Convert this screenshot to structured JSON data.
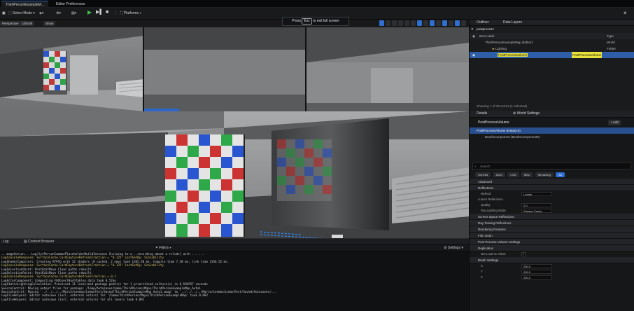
{
  "tabs": [
    {
      "label": "ThirdPersonExampleM..."
    },
    {
      "label": "Editor Preferences"
    }
  ],
  "toolbar": {
    "mode": "Select Mode",
    "platforms": "Platforms"
  },
  "viewport": {
    "buttons": [
      "Perspective",
      "Lit/Unlit",
      "Show"
    ],
    "tooltip_pre": "Press",
    "tooltip_key": "Esc",
    "tooltip_post": "to exit full screen"
  },
  "outliner": {
    "title": "Outliner",
    "tab2": "Data Layers",
    "search": "postprocess",
    "col_label": "Item Label",
    "col_type": "Type",
    "rows": [
      {
        "label": "ThirdPersonExampleMap (Editor)",
        "type": "World"
      },
      {
        "label": "Lighting",
        "type": "Folder"
      },
      {
        "label": "PostProcessVolume",
        "type": "PostProcessVolume"
      }
    ],
    "status": "Showing 1 of 33 actors (1 selected)"
  },
  "details": {
    "title": "Details",
    "tab2": "World Settings",
    "actor": "PostProcessVolume",
    "add": "+ Add",
    "comp_root": "PostProcessVolume (Instance)",
    "comp_child": "BrushComponent (BrushComponent0)",
    "search": "Search",
    "filters": [
      "General",
      "Actor",
      "LOD",
      "Misc",
      "Streaming",
      "All"
    ],
    "sections": [
      "Advanced",
      "Reflections",
      "Screen Space Reflections",
      "Ray Tracing Reflections",
      "Rendering Features",
      "Film Grain",
      "Post Process Volume Settings",
      "Replication",
      "Brush Settings"
    ],
    "props": {
      "method": "Method",
      "method_val": "Lumen",
      "lumen": "Lumen Reflections",
      "quality": "Quality",
      "quality_val": "2.0",
      "raylight": "Ray Lighting Mode",
      "raylight_val": "Surface Cache",
      "netload": "Net Load on Client",
      "x": "X",
      "y": "Y",
      "z": "Z",
      "x_val": "200.0",
      "y_val": "200.0",
      "z_val": "200.0"
    }
  },
  "console": {
    "tab1": "Log",
    "tab2": "Content Browser",
    "filters": "Filters",
    "settings": "Settings",
    "lines": [
      "...mageAction... Log/lyrPersonCommonPlaceholderBuildInstance Incluing to a ..recording about a rcluds] with ...  ...",
      "LogConsoleResponse: SurfaceCache.CardCaptureRefreshFraction = \"0.125\"    LastSetBy: Scalability",
      "LogShaderCompilers: Creating RTPSO with 32 shaders (0 cached, 2 new) took 1365.50 ms. Compile time 7.38 ms, link time 1356.52 ms.",
      "LogConsoleResponse: SurfaceCache.CardCaptureRefreshFraction = \"0.125\"    LastSetBy: Scalability",
      "LogSelectionPoint: PostEditMove Clear paths rebuilt",
      "LogSelectionPoint: PostEditMove Clear paths rebuilt",
      "LogConsoleResponse: SurfaceCache.CardCaptureRefreshFraction = 0.1",
      "LogActorComponent: Compacting FUObjectHashTables data took   0.52ms",
      "LogStaticLightingCalculation: Processed 11 localized package path(s) for 1 prioritized culture(s) in 0.594557 seconds",
      "SourceControl: Moving output files for package: /Temp/Autosaves/Game/ThirdPerson/Maps/ThirdPersonExampleMap_Auto1",
      "SourceControl: Moving '../../../../Marie/Leemon/LemonTest/Saved/ThirdPersonExampleMap_Auto1.umap' to '../../../../Marie/Leemon/LemonTest/Saved/Autosaves/...",
      "LogFileHelpers: Editor autosave (incl. external actors) for '/Game/ThirdPerson/Maps/ThirdPersonExampleMap' took 0.092",
      "LogFileHelpers: Editor autosave (incl. external actors) for all levels took 0.092"
    ]
  },
  "colors": {
    "accent": "#2f6fd0",
    "play": "#3fbf4a",
    "highlight": "#e7e03a",
    "selection": "#2f5ea8"
  }
}
